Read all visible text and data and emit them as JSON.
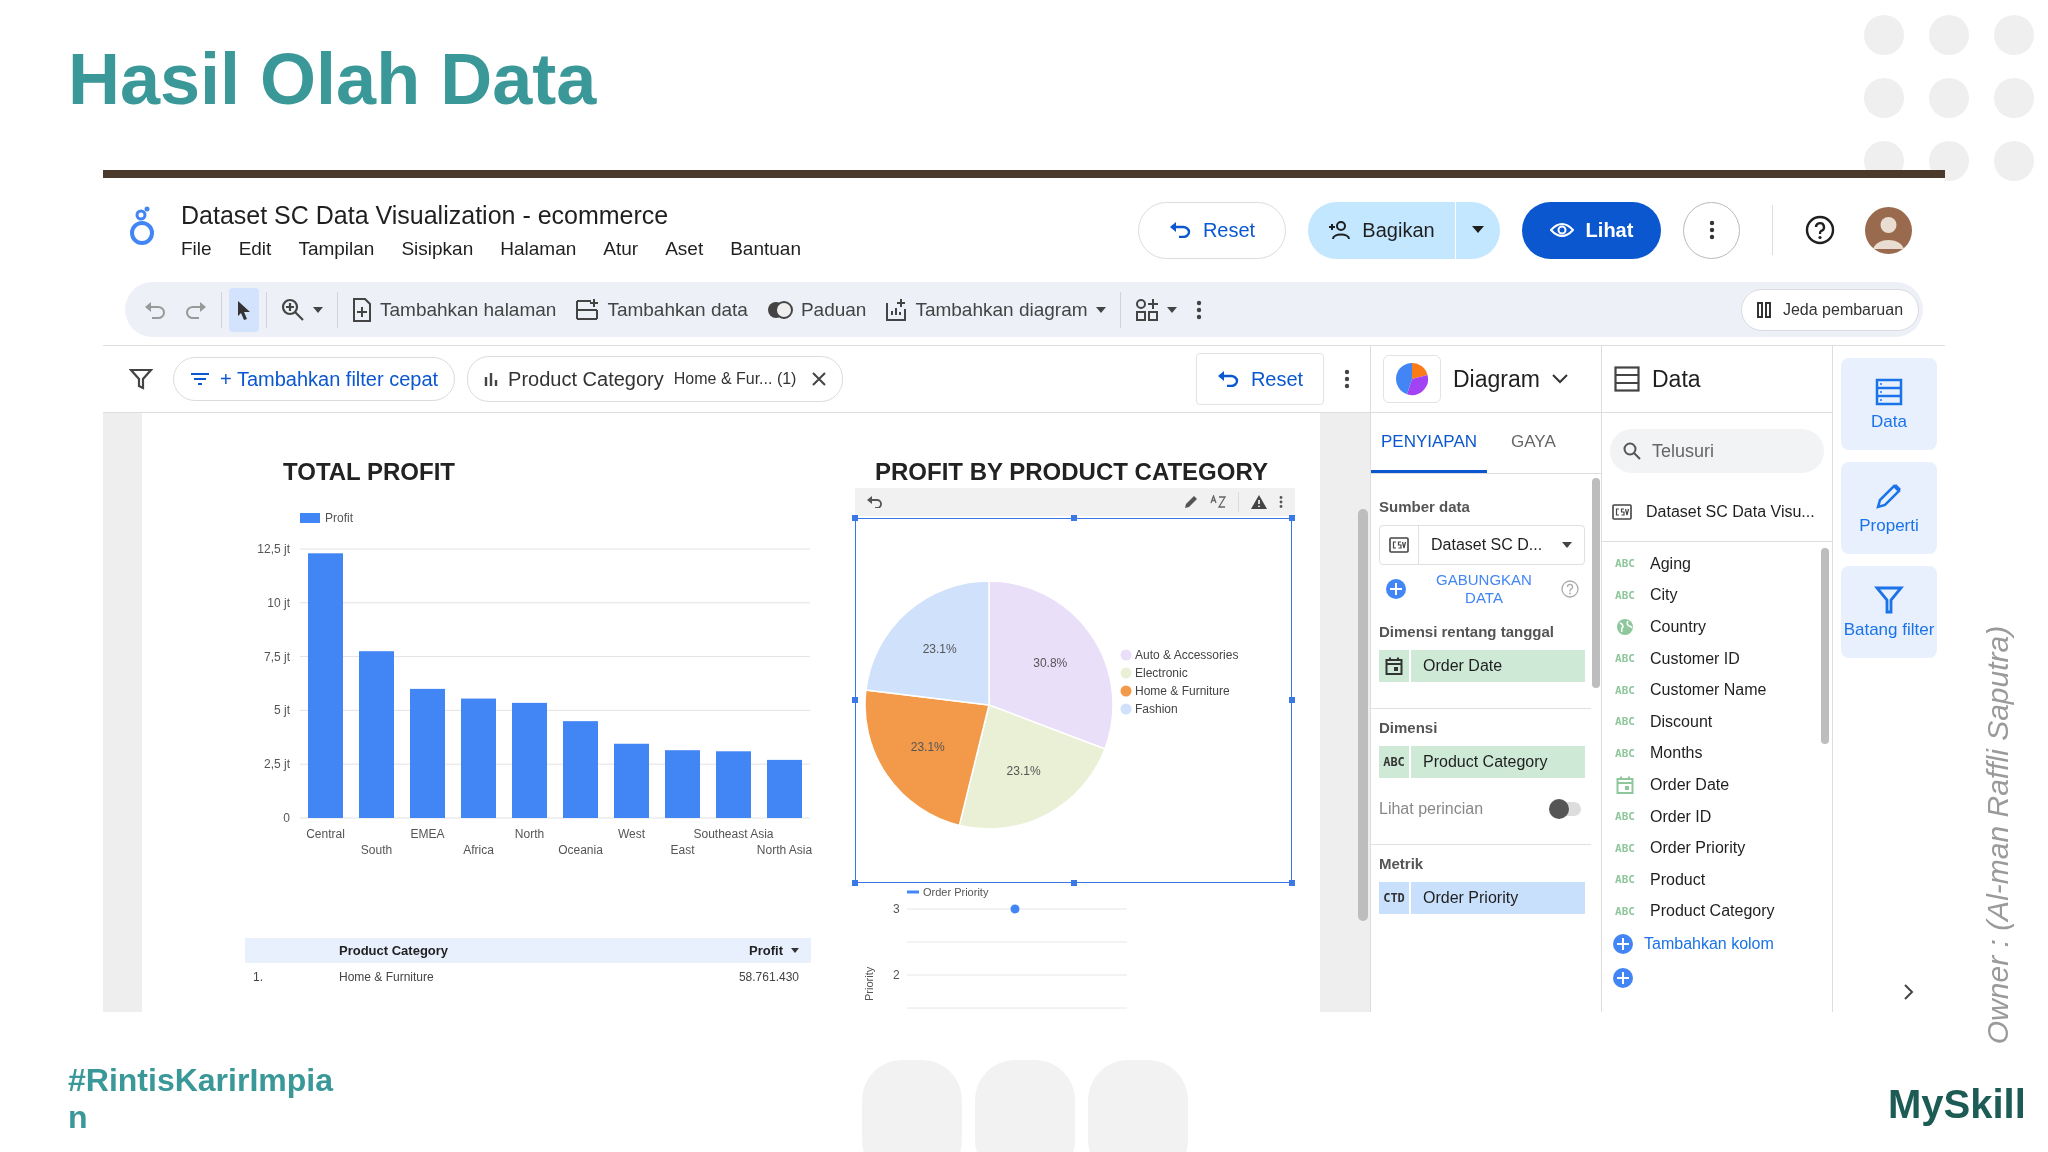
{
  "slide": {
    "title": "Hasil Olah Data",
    "hashtag": "#RintisKarirImpian",
    "brand": "MySkill",
    "owner_note": "Owner : (Al-man Raffli Saputra)"
  },
  "app": {
    "doc_title": "Dataset SC Data Visualization - ecommerce",
    "menu": [
      "File",
      "Edit",
      "Tampilan",
      "Sisipkan",
      "Halaman",
      "Atur",
      "Aset",
      "Bantuan"
    ],
    "header_buttons": {
      "reset": "Reset",
      "share": "Bagikan",
      "view": "Lihat"
    },
    "toolbar": [
      {
        "kind": "undo",
        "selected": false
      },
      {
        "kind": "redo",
        "selected": false
      },
      {
        "kind": "pointer",
        "selected": true
      },
      {
        "kind": "zoom",
        "selected": false
      },
      {
        "kind": "add-page",
        "label": "Tambahkan halaman",
        "selected": false
      },
      {
        "kind": "add-data",
        "label": "Tambahkan data",
        "selected": false
      },
      {
        "kind": "theme",
        "label": "Paduan",
        "selected": false
      },
      {
        "kind": "add-chart",
        "label": "Tambahkan diagram",
        "selected": false
      },
      {
        "kind": "controls",
        "selected": false
      },
      {
        "kind": "more",
        "selected": false
      }
    ],
    "pause_button": "Jeda pembaruan",
    "filter_bar": {
      "add_filter": "+ Tambahkan filter cepat",
      "chip_field": "Product Category",
      "chip_value": "Home & Fur... (1)",
      "reset": "Reset"
    }
  },
  "report": {
    "bar_chart": {
      "title": "TOTAL PROFIT",
      "chart_data": {
        "type": "bar",
        "categories": [
          "Central",
          "South",
          "EMEA",
          "Africa",
          "North",
          "Oceania",
          "West",
          "East",
          "Southeast Asia",
          "North Asia"
        ],
        "series": [
          {
            "name": "Profit",
            "color": "#4285f4",
            "values": [
              12.3,
              7.75,
              6.0,
              5.55,
              5.35,
              4.5,
              3.45,
              3.15,
              3.1,
              2.7
            ]
          }
        ],
        "grid": true,
        "legend": "top",
        "ylim": [
          0,
          12.5
        ],
        "yticks": [
          {
            "value": 0,
            "label": "0"
          },
          {
            "value": 2.5,
            "label": "2,5 jt"
          },
          {
            "value": 5,
            "label": "5 jt"
          },
          {
            "value": 7.5,
            "label": "7,5 jt"
          },
          {
            "value": 10,
            "label": "10 jt"
          },
          {
            "value": 12.5,
            "label": "12,5 jt"
          }
        ]
      }
    },
    "table": {
      "columns": [
        "Product Category",
        "Profit"
      ],
      "rows": [
        {
          "index": "1.",
          "category": "Home & Furniture",
          "profit": "58.761.430"
        }
      ]
    },
    "pie_chart": {
      "title": "PROFIT BY PRODUCT CATEGORY",
      "chart_data": {
        "type": "pie",
        "categories": [
          "Auto & Accessories",
          "Electronic",
          "Home & Furniture",
          "Fashion"
        ],
        "values": [
          30.8,
          23.1,
          23.1,
          23.1
        ],
        "colors": [
          "#e9dff9",
          "#eaf0d6",
          "#f29a4a",
          "#d0e1fc"
        ],
        "legend": "right",
        "value_labels": [
          "30.8%",
          "23.1%",
          "23.1%",
          "23.1%"
        ]
      }
    },
    "line_chart": {
      "chart_data": {
        "type": "line",
        "ylabel": "Priority",
        "grid": true,
        "ylim": [
          1.5,
          3
        ],
        "yticks": [
          2,
          3
        ],
        "series": [
          {
            "name": "Order Priority",
            "color": "#4285f4",
            "marker": true,
            "values": [
              3
            ]
          }
        ]
      }
    }
  },
  "diagram_panel": {
    "title": "Diagram",
    "tabs": [
      {
        "label": "PENYIAPAN",
        "selected": true
      },
      {
        "label": "GAYA",
        "selected": false
      }
    ],
    "data_source_label": "Sumber data",
    "data_source": "Dataset SC D...",
    "blend": "GABUNGKAN DATA",
    "date_range_label": "Dimensi rentang tanggal",
    "date_range_field": "Order Date",
    "dimension_label": "Dimensi",
    "dimension": {
      "badge": "ABC",
      "name": "Product Category"
    },
    "drilldown": {
      "label": "Lihat perincian",
      "on": false
    },
    "metric_label": "Metrik",
    "metric": {
      "badge": "CTD",
      "name": "Order Priority"
    }
  },
  "data_panel": {
    "title": "Data",
    "search": {
      "placeholder": "Telusuri"
    },
    "dataset": "Dataset SC Data Visu...",
    "fields": [
      {
        "kind": "text",
        "badge": "ABC",
        "name": "Aging"
      },
      {
        "kind": "text",
        "badge": "ABC",
        "name": "City"
      },
      {
        "kind": "geo",
        "name": "Country"
      },
      {
        "kind": "text",
        "badge": "ABC",
        "name": "Customer ID"
      },
      {
        "kind": "text",
        "badge": "ABC",
        "name": "Customer Name"
      },
      {
        "kind": "text",
        "badge": "ABC",
        "name": "Discount"
      },
      {
        "kind": "text",
        "badge": "ABC",
        "name": "Months"
      },
      {
        "kind": "date",
        "name": "Order Date"
      },
      {
        "kind": "text",
        "badge": "ABC",
        "name": "Order ID"
      },
      {
        "kind": "text",
        "badge": "ABC",
        "name": "Order Priority"
      },
      {
        "kind": "text",
        "badge": "ABC",
        "name": "Product"
      },
      {
        "kind": "text",
        "badge": "ABC",
        "name": "Product Category"
      }
    ],
    "add_field": "Tambahkan kolom"
  },
  "side_rail": [
    {
      "kind": "data",
      "label": "Data"
    },
    {
      "kind": "properties",
      "label": "Properti"
    },
    {
      "kind": "filter",
      "label": "Batang filter"
    }
  ]
}
